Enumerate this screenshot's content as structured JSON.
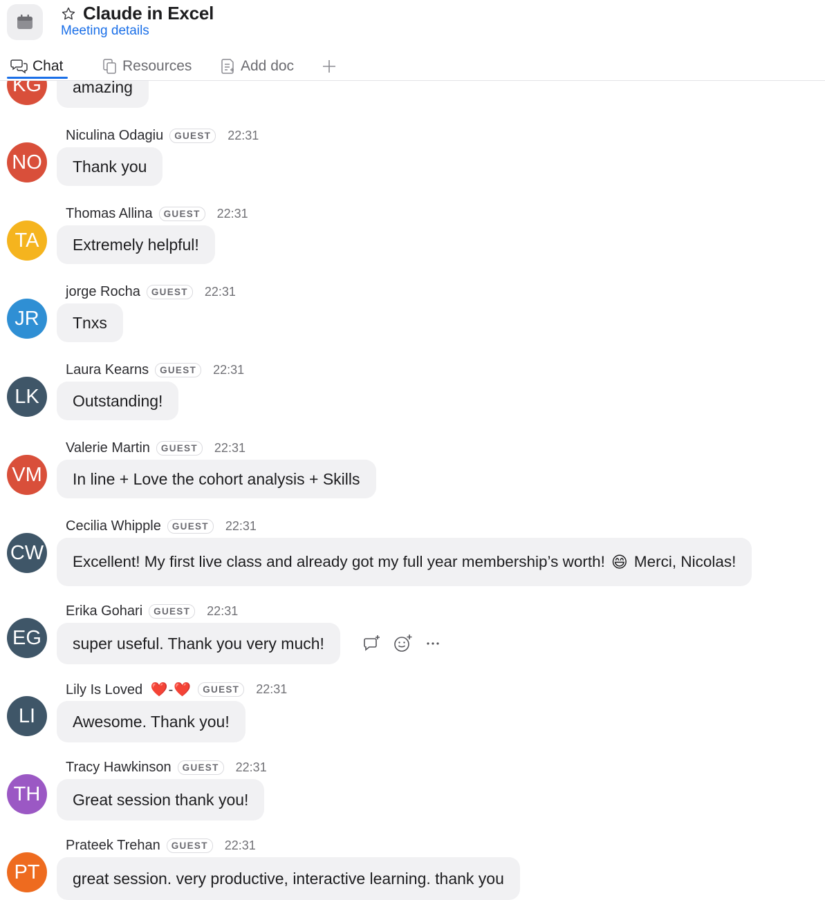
{
  "header": {
    "title": "Claude in Excel",
    "details_link": "Meeting details",
    "tabs": [
      {
        "label": "Chat",
        "active": true
      },
      {
        "label": "Resources",
        "active": false
      },
      {
        "label": "Add doc",
        "active": false
      }
    ]
  },
  "colors": {
    "accent": "#1a6fe8",
    "bubble": "#f1f1f3",
    "avatar_red": "#d94f3a",
    "avatar_yellow": "#f5b41e",
    "avatar_blue": "#2f8fd4",
    "avatar_slate": "#3f5668",
    "avatar_purple": "#9b58c4",
    "avatar_orange": "#ee6b1f"
  },
  "messages": [
    {
      "initials": "KG",
      "text": "amazing",
      "partial": true
    },
    {
      "initials": "NO",
      "name": "Niculina Odagiu",
      "badge": "GUEST",
      "time": "22:31",
      "text": "Thank you"
    },
    {
      "initials": "TA",
      "name": "Thomas Allina",
      "badge": "GUEST",
      "time": "22:31",
      "text": "Extremely helpful!"
    },
    {
      "initials": "JR",
      "name": "jorge Rocha",
      "badge": "GUEST",
      "time": "22:31",
      "text": "Tnxs"
    },
    {
      "initials": "LK",
      "name": "Laura Kearns",
      "badge": "GUEST",
      "time": "22:31",
      "text": "Outstanding!"
    },
    {
      "initials": "VM",
      "name": "Valerie Martin",
      "badge": "GUEST",
      "time": "22:31",
      "text": "In line + Love the cohort analysis + Skills"
    },
    {
      "initials": "CW",
      "name": "Cecilia Whipple",
      "badge": "GUEST",
      "time": "22:31",
      "text_before": "Excellent! My first live class and already got my full year membership’s worth!",
      "emoji": "😄",
      "text_after": "Merci, Nicolas!"
    },
    {
      "initials": "EG",
      "name": "Erika Gohari",
      "badge": "GUEST",
      "time": "22:31",
      "text": "super useful. Thank you very much!",
      "hover_actions": [
        "reply-in-thread-icon",
        "add-reaction-icon",
        "more-options-icon"
      ]
    },
    {
      "initials": "LI",
      "name_before": "Lily Is Loved",
      "name_emoji_1": "❤️",
      "name_sep": "-",
      "name_emoji_2": "❤️",
      "badge": "GUEST",
      "time": "22:31",
      "text": "Awesome. Thank you!"
    },
    {
      "initials": "TH",
      "name": "Tracy Hawkinson",
      "badge": "GUEST",
      "time": "22:31",
      "text": "Great session thank you!"
    },
    {
      "initials": "PT",
      "name": "Prateek Trehan",
      "badge": "GUEST",
      "time": "22:31",
      "text": "great session. very productive, interactive learning. thank you"
    }
  ]
}
